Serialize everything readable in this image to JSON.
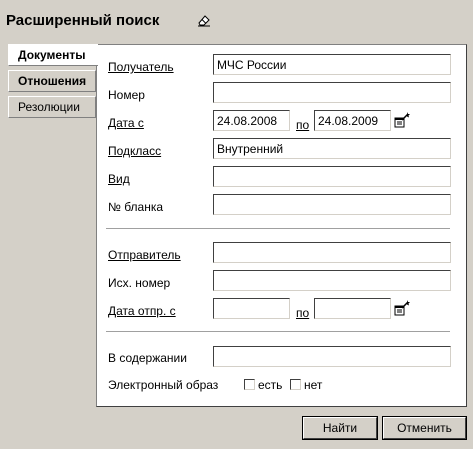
{
  "header": {
    "title": "Расширенный поиск"
  },
  "tabs": [
    {
      "label": "Документы"
    },
    {
      "label": "Отношения"
    },
    {
      "label": "Резолюции"
    }
  ],
  "form": {
    "recipient_label": "Получатель",
    "recipient_value": "МЧС России",
    "number_label": "Номер",
    "number_value": "",
    "date_from_label": "Дата с",
    "date_from_value": "24.08.2008",
    "date_to_label": "по",
    "date_to_value": "24.08.2009",
    "subclass_label": "Подкласс",
    "subclass_value": "Внутренний",
    "kind_label": "Вид",
    "kind_value": "",
    "blank_no_label": "№ бланка",
    "blank_no_value": "",
    "sender_label": "Отправитель",
    "sender_value": "",
    "out_number_label": "Исх. номер",
    "out_number_value": "",
    "send_date_from_label": "Дата отпр. с",
    "send_date_from_value": "",
    "send_date_to_label": "по",
    "send_date_to_value": "",
    "content_label": "В содержании",
    "content_value": "",
    "eimage_label": "Электронный образ",
    "eimage_yes_label": "есть",
    "eimage_no_label": "нет"
  },
  "buttons": {
    "find_label": "Найти",
    "cancel_label": "Отменить"
  },
  "icons": {
    "title_icon": "eraser-icon",
    "calendar_icon": "calendar-wand-icon"
  }
}
